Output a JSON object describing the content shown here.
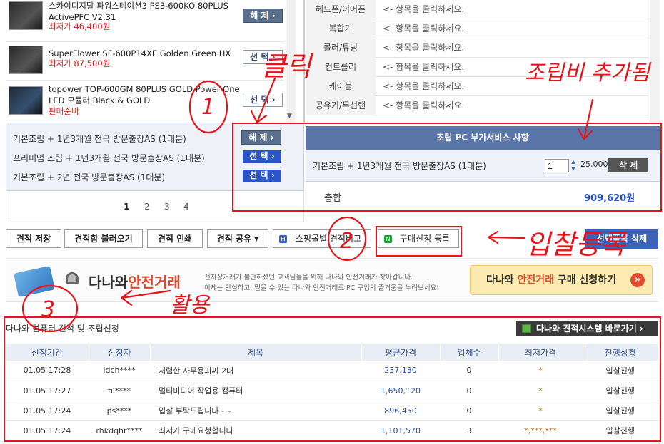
{
  "products": [
    {
      "name": "스카이디지탈 파워스테이션3 PS3-600KO 80PLUS ActivePFC V2.31",
      "price": "최저가 46,400원",
      "button": "해 제 ›"
    },
    {
      "name": "SuperFlower SF-600P14XE Golden Green HX",
      "price": "최저가 87,500원",
      "button": "선 택 ›"
    },
    {
      "name": "topower TOP-600GM 80PLUS GOLD Power One LED 모듈러 Black & GOLD",
      "price": "판매준비",
      "button": "선 택 ›"
    }
  ],
  "categories": [
    {
      "label": "헤드폰/이어폰",
      "hint": "<- 항목을 클릭하세요."
    },
    {
      "label": "복합기",
      "hint": "<- 항목을 클릭하세요."
    },
    {
      "label": "콜러/튜닝",
      "hint": "<- 항목을 클릭하세요."
    },
    {
      "label": "컨트롤러",
      "hint": "<- 항목을 클릭하세요."
    },
    {
      "label": "케이블",
      "hint": "<- 항목을 클릭하세요."
    },
    {
      "label": "공유기/무선랜",
      "hint": "<- 항목을 클릭하세요."
    }
  ],
  "services": [
    {
      "label": "기본조립 + 1년3개월 전국 방문출장AS (1대분)",
      "button": "해 제 ›"
    },
    {
      "label": "프리미엄 조립 + 1년3개월 전국 방문출장AS (1대분)",
      "button": "선 택 ›"
    },
    {
      "label": "기본조립 + 2년 전국 방문출장AS (1대분)",
      "button": "선 택 ›"
    }
  ],
  "pages": [
    "1",
    "2",
    "3",
    "4"
  ],
  "addon": {
    "header": "조립 PC 부가서비스 사항",
    "item": "기본조립 + 1년3개월 전국 방문출장AS (1대분)",
    "qty": "1",
    "price": "25,000",
    "delete": "삭 제",
    "total_label": "총합",
    "total_value": "909,620원"
  },
  "toolbar": {
    "save": "견적 저장",
    "load": "견적함 불러오기",
    "print": "견적 인쇄",
    "share": "견적 공유 ▾",
    "compare": "쇼핑몰별 견적비교",
    "purchase": "구매신청 등록",
    "delete_sel": "선택품목 삭제"
  },
  "banner": {
    "logo_a": "다나와",
    "logo_b": "안전거래",
    "desc1": "전자상거래가 불안하셨던 고객님들을 위해 다나와 안전거래가 찾아갑니다.",
    "desc2": "이제는 안심하고, 믿을 수 있는 다나와 안전거래로 PC 구입의 즐거움을 누려보세요!",
    "cta_a": "다나와 ",
    "cta_b": "안전거래",
    "cta_c": " 구매 신청하기",
    "cta_arrow": "»"
  },
  "section": {
    "title": "다나와 컴퓨터 견적 및 조립신청",
    "link": "다나와 견적시스템 바로가기 ›"
  },
  "table": {
    "headers": [
      "신청기간",
      "신청자",
      "제목",
      "평균가격",
      "업체수",
      "최저가격",
      "진행상황"
    ],
    "rows": [
      [
        "01.05 17:28",
        "idch****",
        "저렴한 사무용피씨 2대",
        "237,130",
        "0",
        "*",
        "입찰진행"
      ],
      [
        "01.05 17:27",
        "fil****",
        "멀티미디어 작업용 컴퓨터",
        "1,650,120",
        "0",
        "*",
        "입찰진행"
      ],
      [
        "01.05 17:24",
        "ps****",
        "입찰 부탁드립니다~~",
        "896,450",
        "0",
        "*",
        "입찰진행"
      ],
      [
        "01.05 17:24",
        "rhkdqhr****",
        "최저가 구매요청합니다",
        "1,101,570",
        "3",
        "*,***,***",
        "입찰진행"
      ]
    ]
  },
  "annotations": {
    "click": "클릭",
    "assembly": "조립비 추가됨",
    "bid": "입찰등록",
    "use": "활용",
    "n1": "1",
    "n2": "2",
    "n3": "3"
  },
  "colors": {
    "accent_red": "#e8121b",
    "header_blue": "#5a75a8",
    "select_blue": "#2b55c6",
    "price_red": "#d0201c"
  }
}
